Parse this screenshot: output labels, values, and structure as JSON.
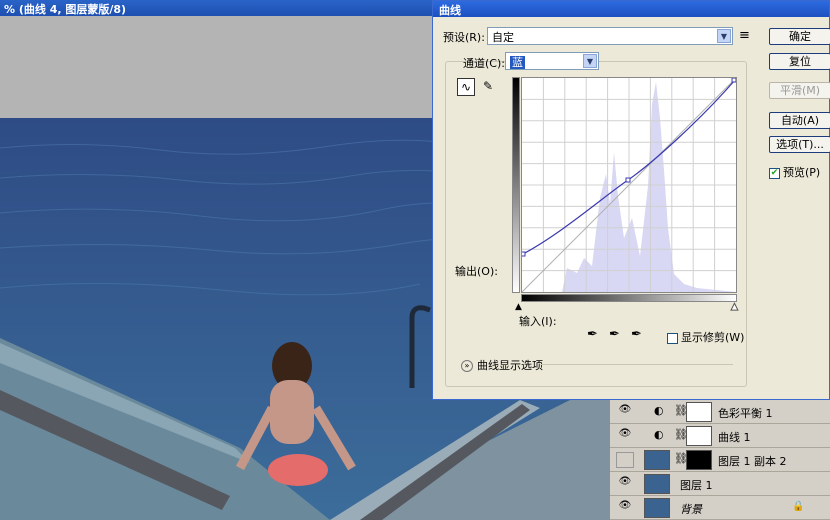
{
  "document": {
    "title": "% (曲线 4, 图层蒙版/8)"
  },
  "dialog": {
    "title": "曲线",
    "preset_label": "预设(R):",
    "preset_value": "自定",
    "channel_label": "通道(C):",
    "channel_value": "蓝",
    "output_label": "输出(O):",
    "input_label": "输入(I):",
    "show_clipping_label": "显示修剪(W)",
    "curve_display_label": "曲线显示选项",
    "preview_label": "预览(P)",
    "buttons": {
      "ok": "确定",
      "reset": "复位",
      "smooth": "平滑(M)",
      "auto": "自动(A)",
      "options": "选项(T)..."
    }
  },
  "layers": [
    {
      "name": "色彩平衡 1",
      "visible": true
    },
    {
      "name": "曲线 1",
      "visible": true
    },
    {
      "name": "图层 1 副本 2",
      "visible": false
    },
    {
      "name": "图层 1",
      "visible": true
    },
    {
      "name": "背景",
      "visible": true
    }
  ],
  "colors": {
    "accent": "#1c50c0",
    "curve": "#3a3ab0",
    "histogram": "#d8d8f4"
  }
}
